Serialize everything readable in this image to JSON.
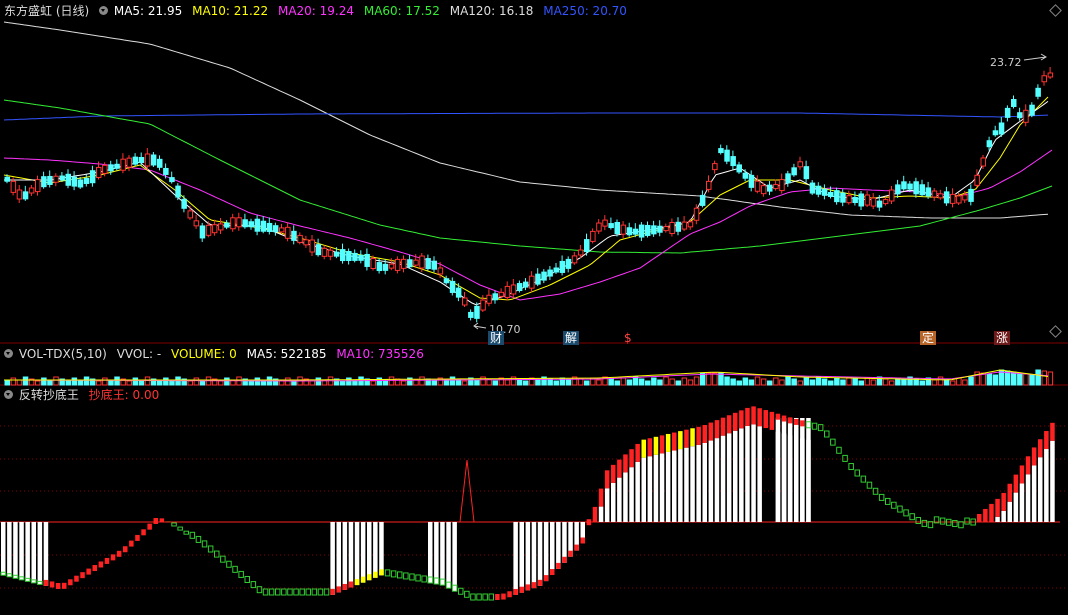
{
  "main": {
    "stock": "东方盛虹 (日线)",
    "ma": [
      {
        "label": "MA5: 21.95",
        "color": "#ffffff"
      },
      {
        "label": "MA10: 21.22",
        "color": "#ffff00"
      },
      {
        "label": "MA20: 19.24",
        "color": "#ff33ff"
      },
      {
        "label": "MA60: 17.52",
        "color": "#33ee33"
      },
      {
        "label": "MA120: 16.18",
        "color": "#dddddd"
      },
      {
        "label": "MA250: 20.70",
        "color": "#3355ff"
      }
    ],
    "high_label": "23.72",
    "low_label": "10.70",
    "events": [
      {
        "label": "财",
        "bg": "#1a4a6e",
        "color": "#ffffff"
      },
      {
        "label": "解",
        "bg": "#1a4a6e",
        "color": "#ffffff"
      },
      {
        "label": "$",
        "bg": "#000000",
        "color": "#ff4444"
      },
      {
        "label": "定",
        "bg": "#b8652a",
        "color": "#ffffff"
      },
      {
        "label": "涨",
        "bg": "#6e1a1a",
        "color": "#ffffff"
      }
    ]
  },
  "volume": {
    "name": "VOL-TDX(5,10)",
    "vvol": "VVOL: -",
    "volume": "VOLUME: 0",
    "ma5": "MA5: 522185",
    "ma10": "MA10: 735526"
  },
  "indicator": {
    "name": "反转抄底王",
    "value": "抄底王: 0.00"
  },
  "colors": {
    "up": "#ff3333",
    "down": "#55ffff",
    "ma5": "#ffffff",
    "ma10": "#ffff00",
    "ma20": "#ff33ff",
    "ma60": "#33ee33",
    "ma120": "#dddddd",
    "ma250": "#3355ff",
    "grid": "#880000",
    "green": "#33cc33"
  }
}
